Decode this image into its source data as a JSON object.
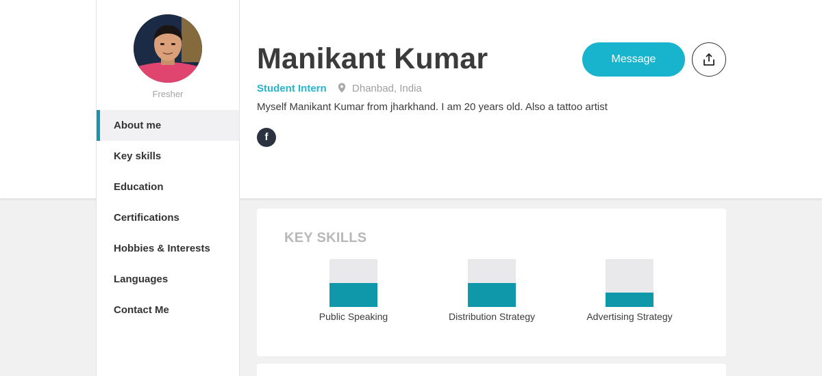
{
  "sidebar": {
    "role_tag": "Fresher",
    "items": [
      {
        "label": "About me",
        "active": true
      },
      {
        "label": "Key skills",
        "active": false
      },
      {
        "label": "Education",
        "active": false
      },
      {
        "label": "Certifications",
        "active": false
      },
      {
        "label": "Hobbies & Interests",
        "active": false
      },
      {
        "label": "Languages",
        "active": false
      },
      {
        "label": "Contact Me",
        "active": false
      }
    ]
  },
  "profile": {
    "name": "Manikant Kumar",
    "position": "Student Intern",
    "location": "Dhanbad, India",
    "bio": "Myself Manikant Kumar from jharkhand. I am 20 years old. Also a tattoo artist",
    "social_icon": "f",
    "message_label": "Message"
  },
  "skills": {
    "title": "KEY SKILLS",
    "items": [
      {
        "label": "Public Speaking",
        "level": 0.5
      },
      {
        "label": "Distribution Strategy",
        "level": 0.5
      },
      {
        "label": "Advertising Strategy",
        "level": 0.3
      }
    ]
  },
  "colors": {
    "accent": "#18b3cc",
    "bar_fill": "#0f98aa",
    "bar_track": "#e9e9ec"
  }
}
